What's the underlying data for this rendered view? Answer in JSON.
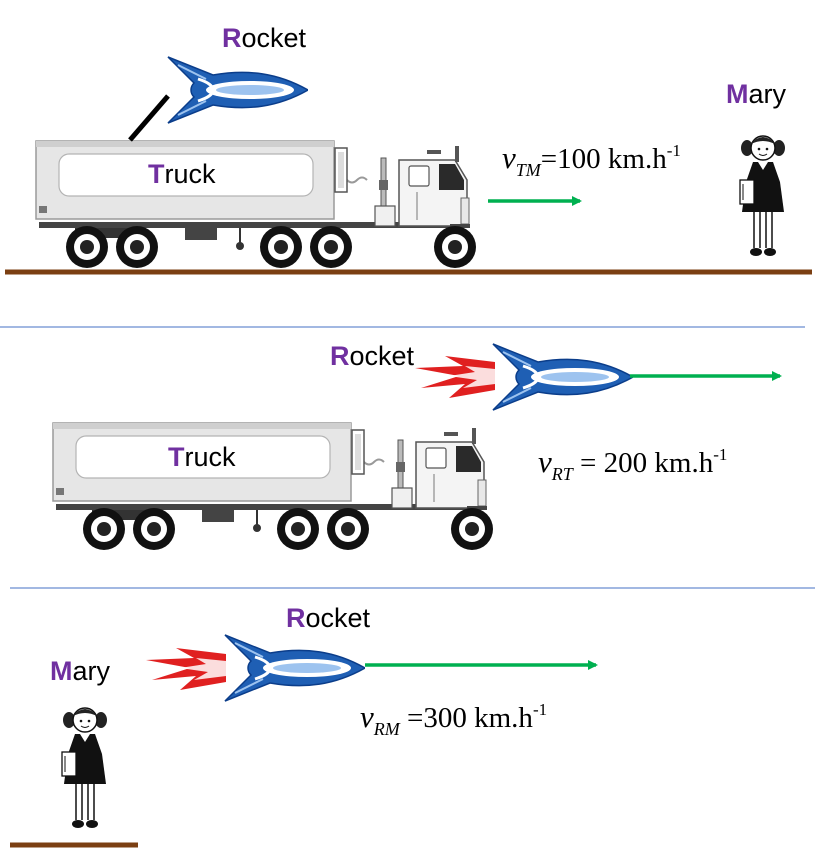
{
  "colors": {
    "ground": "#7b3f12",
    "velocity_arrow": "#00b050",
    "label_initial": "#7030a0",
    "separator": "#4472c4",
    "rocket_blue": "#1f5fb4",
    "flame_red": "#e02020"
  },
  "panels": [
    {
      "rocket": {
        "initial": "R",
        "rest": "ocket"
      },
      "truck": {
        "initial": "T",
        "rest": "ruck"
      },
      "mary": {
        "initial": "M",
        "rest": "ary"
      },
      "equation": {
        "v": "v",
        "sub": "TM",
        "eq": "=100 km.h",
        "sup": "-1"
      }
    },
    {
      "rocket": {
        "initial": "R",
        "rest": "ocket"
      },
      "truck": {
        "initial": "T",
        "rest": "ruck"
      },
      "equation": {
        "v": "v",
        "sub": "RT",
        "eq": " = 200 km.h",
        "sup": "-1"
      }
    },
    {
      "rocket": {
        "initial": "R",
        "rest": "ocket"
      },
      "mary": {
        "initial": "M",
        "rest": "ary"
      },
      "equation": {
        "v": "v",
        "sub": "RM",
        "eq": " =300 km.h",
        "sup": "-1"
      }
    }
  ]
}
